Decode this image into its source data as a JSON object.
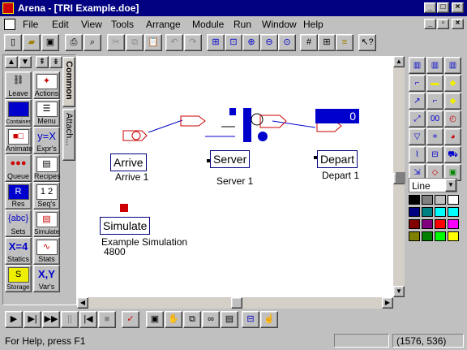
{
  "window": {
    "title": "Arena - [TRI Example.doe]"
  },
  "menu": [
    "File",
    "Edit",
    "View",
    "Tools",
    "Arrange",
    "Module",
    "Run",
    "Window",
    "Help"
  ],
  "toolbar": {
    "icons": [
      "new-file-icon",
      "open-folder-icon",
      "save-icon",
      "print-icon",
      "print-preview-icon",
      "cut-icon",
      "copy-icon",
      "paste-icon",
      "undo-icon",
      "redo-icon",
      "zoom-all-icon",
      "zoom-fit-icon",
      "zoom-in-icon",
      "zoom-out-icon",
      "zoom-previous-icon",
      "grid-icon",
      "snap-icon",
      "layers-icon",
      "context-help-icon"
    ]
  },
  "panel_tabs": {
    "common": "Common",
    "attach": "Attach..."
  },
  "panel_buttons": [
    "Leave",
    "Actions",
    "Container",
    "Menu",
    "Animate",
    "Expr's",
    "Queue",
    "Recipes",
    "Res",
    "Seq's",
    "Sets",
    "Simulate",
    "Statics",
    "Stats",
    "Storage",
    "Var's"
  ],
  "panel_glyphs": {
    "res": "R",
    "sets": "{abc}",
    "statics": "X=4",
    "vars": "X,Y",
    "exprs": "y=X"
  },
  "canvas": {
    "arrive": {
      "label": "Arrive",
      "sub": "Arrive 1"
    },
    "server": {
      "label": "Server",
      "sub": "Server 1"
    },
    "depart": {
      "label": "Depart",
      "sub": "Depart 1",
      "counter": "0"
    },
    "simulate": {
      "label": "Simulate",
      "line1": "Example Simulation",
      "line2": "4800"
    }
  },
  "line_style": {
    "selected": "Line"
  },
  "colors": [
    "#000000",
    "#808080",
    "#c0c0c0",
    "#ffffff",
    "#000080",
    "#008080",
    "#00ffff",
    "#00ffff",
    "#800000",
    "#800080",
    "#ff0000",
    "#ff00ff",
    "#808000",
    "#008000",
    "#00ff00",
    "#ffff00"
  ],
  "status": {
    "help": "For Help, press F1",
    "coords": "(1576, 536)"
  }
}
